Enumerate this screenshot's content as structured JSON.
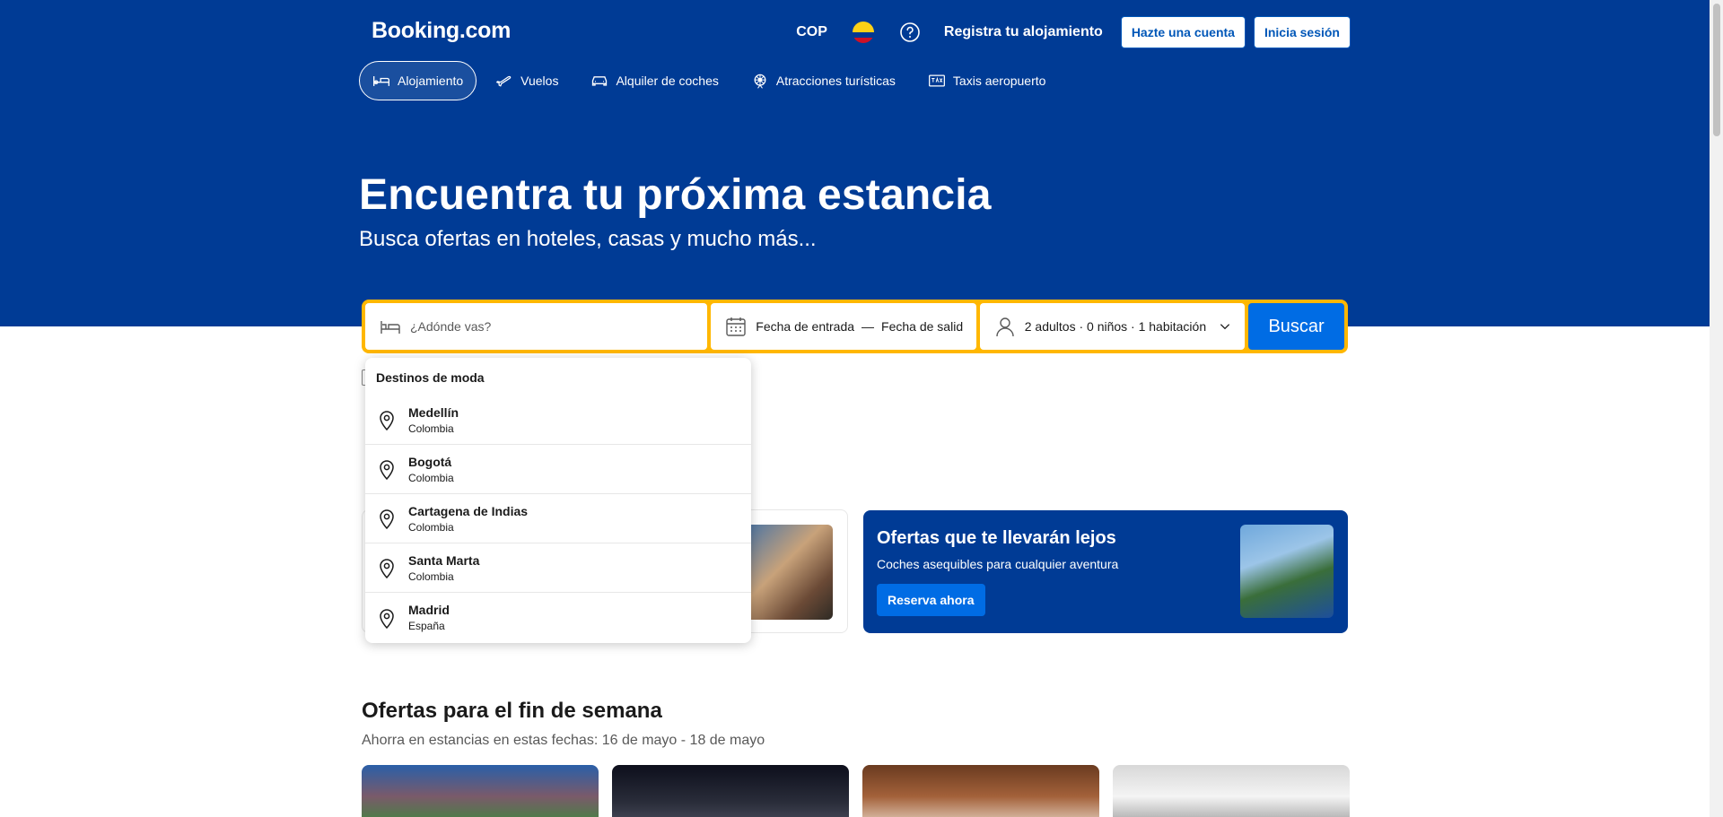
{
  "header": {
    "logo": "Booking.com",
    "currency": "COP",
    "register_label": "Registra tu alojamiento",
    "signup_label": "Hazte una cuenta",
    "signin_label": "Inicia sesión"
  },
  "nav": {
    "items": [
      {
        "label": "Alojamiento",
        "icon": "bed-icon",
        "active": true
      },
      {
        "label": "Vuelos",
        "icon": "plane-icon"
      },
      {
        "label": "Alquiler de coches",
        "icon": "car-icon"
      },
      {
        "label": "Atracciones turísticas",
        "icon": "attractions-icon"
      },
      {
        "label": "Taxis aeropuerto",
        "icon": "taxi-icon"
      }
    ]
  },
  "hero": {
    "title": "Encuentra tu próxima estancia",
    "subtitle": "Busca ofertas en hoteles, casas y mucho más..."
  },
  "search": {
    "destination_placeholder": "¿Adónde vas?",
    "checkin_label": "Fecha de entrada",
    "dates_separator": "—",
    "checkout_label": "Fecha de salid",
    "guests_label": "2 adultos · 0 niños · 1 habitación",
    "search_button": "Buscar"
  },
  "dropdown": {
    "heading": "Destinos de moda",
    "items": [
      {
        "city": "Medellín",
        "country": "Colombia"
      },
      {
        "city": "Bogotá",
        "country": "Colombia"
      },
      {
        "city": "Cartagena de Indias",
        "country": "Colombia"
      },
      {
        "city": "Santa Marta",
        "country": "Colombia"
      },
      {
        "city": "Madrid",
        "country": "España"
      }
    ]
  },
  "promo": {
    "title": "Ofertas que te llevarán lejos",
    "subtitle": "Coches asequibles para cualquier aventura",
    "button": "Reserva ahora"
  },
  "weekend": {
    "title": "Ofertas para el fin de semana",
    "subtitle": "Ahorra en estancias en estas fechas: 16 de mayo - 18 de mayo"
  },
  "colors": {
    "brand_blue": "#003b95",
    "action_blue": "#006ce4",
    "search_border": "#ffb700"
  }
}
